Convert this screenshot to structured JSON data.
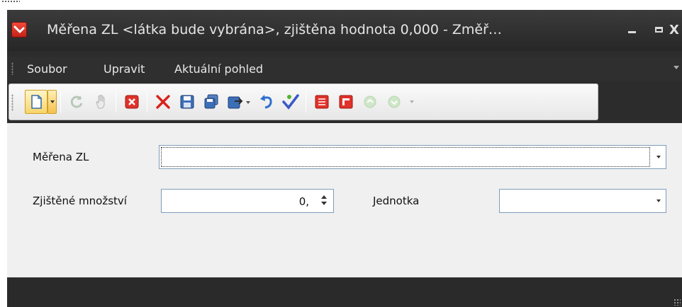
{
  "window": {
    "title": "Měřena ZL <látka bude vybrána>, zjištěna hodnota 0,000  - Změř…",
    "controls": {
      "minimize": "–",
      "maximize": "□",
      "close": "X"
    }
  },
  "menu": {
    "items": [
      "Soubor",
      "Upravit",
      "Aktuální pohled"
    ]
  },
  "toolbar": {
    "buttons": [
      {
        "icon": "new-document-icon"
      },
      {
        "icon": "refresh-icon"
      },
      {
        "icon": "hand-icon"
      },
      {
        "icon": "cancel-icon"
      },
      {
        "icon": "delete-icon"
      },
      {
        "icon": "save-icon"
      },
      {
        "icon": "save-copy-icon"
      },
      {
        "icon": "export-icon"
      },
      {
        "icon": "undo-icon"
      },
      {
        "icon": "check-icon"
      },
      {
        "icon": "report-icon"
      },
      {
        "icon": "exit-icon"
      },
      {
        "icon": "up-icon"
      },
      {
        "icon": "down-icon"
      }
    ]
  },
  "form": {
    "merena_zl": {
      "label": "Měřena ZL",
      "value": ""
    },
    "zjistene_mnozstvi": {
      "label": "Zjištěné množství",
      "value": "0,"
    },
    "jednotka": {
      "label": "Jednotka",
      "value": ""
    }
  },
  "colors": {
    "titlebar": "#303030",
    "content_bg": "#f0f0f0",
    "field_border": "#7f9db9",
    "toolbar_highlight": "#f7d46a"
  }
}
